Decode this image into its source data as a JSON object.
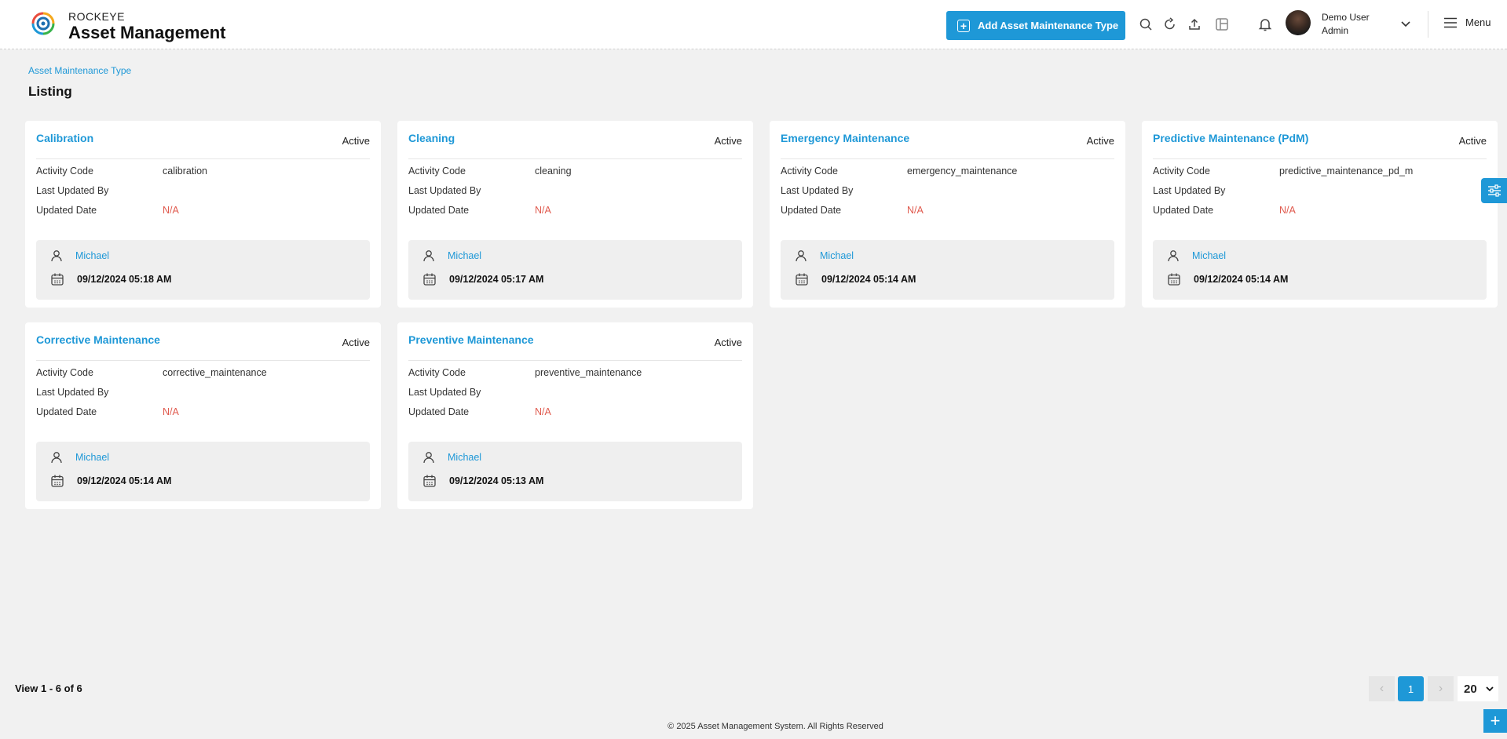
{
  "header": {
    "brand_top": "ROCKEYE",
    "brand_main": "Asset Management",
    "add_button_label": "Add Asset Maintenance Type",
    "user_name": "Demo User",
    "user_role": "Admin",
    "menu_label": "Menu",
    "icons": [
      "search-icon",
      "refresh-icon",
      "upload-icon",
      "layout-icon",
      "bell-icon",
      "chevron-down-icon",
      "hamburger-icon"
    ]
  },
  "page": {
    "breadcrumb": "Asset Maintenance Type",
    "title": "Listing"
  },
  "labels": {
    "activity_code": "Activity Code",
    "last_updated_by": "Last Updated By",
    "updated_date": "Updated Date"
  },
  "cards": [
    {
      "title": "Calibration",
      "status": "Active",
      "activity_code": "calibration",
      "last_updated_by": "",
      "updated_date": "N/A",
      "user": "Michael",
      "datetime": "09/12/2024 05:18 AM"
    },
    {
      "title": "Cleaning",
      "status": "Active",
      "activity_code": "cleaning",
      "last_updated_by": "",
      "updated_date": "N/A",
      "user": "Michael",
      "datetime": "09/12/2024 05:17 AM"
    },
    {
      "title": "Emergency Maintenance",
      "status": "Active",
      "activity_code": "emergency_maintenance",
      "last_updated_by": "",
      "updated_date": "N/A",
      "user": "Michael",
      "datetime": "09/12/2024 05:14 AM"
    },
    {
      "title": "Predictive Maintenance (PdM)",
      "status": "Active",
      "activity_code": "predictive_maintenance_pd_m",
      "last_updated_by": "",
      "updated_date": "N/A",
      "user": "Michael",
      "datetime": "09/12/2024 05:14 AM"
    },
    {
      "title": "Corrective Maintenance",
      "status": "Active",
      "activity_code": "corrective_maintenance",
      "last_updated_by": "",
      "updated_date": "N/A",
      "user": "Michael",
      "datetime": "09/12/2024 05:14 AM"
    },
    {
      "title": "Preventive Maintenance",
      "status": "Active",
      "activity_code": "preventive_maintenance",
      "last_updated_by": "",
      "updated_date": "N/A",
      "user": "Michael",
      "datetime": "09/12/2024 05:13 AM"
    }
  ],
  "footer": {
    "view_count": "View 1 - 6 of 6",
    "current_page": "1",
    "page_size": "20",
    "copyright": "© 2025 Asset Management System. All Rights Reserved"
  },
  "colors": {
    "accent": "#1e98d7",
    "na": "#e05a4e",
    "background": "#f1f1f1"
  }
}
